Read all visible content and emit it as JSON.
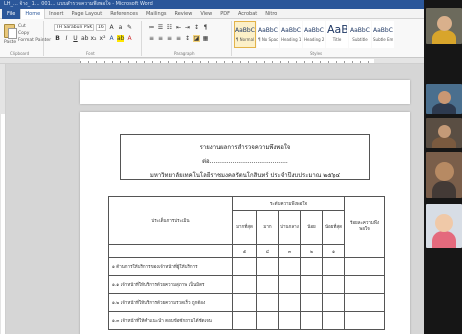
{
  "window": {
    "title_text": "LH_...  จ้าง_ 1... 001...  แบบสำรวจความพึงพอใจ - Microsoft Word"
  },
  "tabs": [
    "File",
    "Home",
    "Insert",
    "Page Layout",
    "References",
    "Mailings",
    "Review",
    "View",
    "PDF",
    "Acrobat",
    "Nitro"
  ],
  "active_tab": "Home",
  "ribbon": {
    "paste_label": "Paste",
    "cut_label": "Cut",
    "copy_label": "Copy",
    "format_painter_label": "Format Painter",
    "font_name": "TH Sarabun PSK",
    "font_size": "16",
    "styles": [
      {
        "sample": "AaBbCcDd",
        "name": "¶ Normal",
        "selected": true
      },
      {
        "sample": "AaBbCcDd",
        "name": "¶ No Spac...",
        "selected": false
      },
      {
        "sample": "AaBbC",
        "name": "Heading 1",
        "selected": false
      },
      {
        "sample": "AaBbCc",
        "name": "Heading 2",
        "selected": false
      },
      {
        "sample": "AaB",
        "name": "Title",
        "selected": false,
        "big": true
      },
      {
        "sample": "AaBbCcl",
        "name": "Subtitle",
        "selected": false
      },
      {
        "sample": "AaBbCcDd",
        "name": "Subtle Em...",
        "selected": false
      }
    ],
    "group_labels": [
      "Clipboard",
      "Font",
      "Paragraph",
      "Styles"
    ]
  },
  "document": {
    "heading_1": "รายงานผลการสำรวจความพึงพอใจ",
    "heading_2": "ต่อ.........................................",
    "heading_3": "มหาวิทยาลัยเทคโนโลยีราชมงคลรัตนโกสินทร์  ประจำปีงบประมาณ ๒๕๖๔",
    "table": {
      "item_header": "ประเด็นการประเมิน",
      "group_header": "ระดับความพึงพอใจ",
      "level_headers": [
        "มากที่สุด",
        "มาก",
        "ปานกลาง",
        "น้อย",
        "น้อยที่สุด"
      ],
      "extra_header": "ร้อยละความพึงพอใจ",
      "score_headers": [
        "๕",
        "๔",
        "๓",
        "๒",
        "๑"
      ],
      "rows": [
        "๑ ด้านการให้บริการของเจ้าหน้าที่ผู้ให้บริการ",
        "๑.๑ เจ้าหน้าที่ให้บริการด้วยความสุภาพ เป็นมิตร",
        "๑.๒ เจ้าหน้าที่ให้บริการด้วยความรวดเร็ว ถูกต้อง",
        "๑.๓ เจ้าหน้าที่ให้คำแนะนำ ตอบข้อซักถามได้ชัดเจน"
      ]
    }
  },
  "participants": [
    {
      "name": "participant-1",
      "bg": "#6c6a5c",
      "skin": "#d9b08c",
      "shirt": "#d8a52b"
    },
    {
      "name": "participant-2",
      "bg": "#4a6f8e",
      "skin": "#c99773",
      "shirt": "#2d3a4f"
    },
    {
      "name": "participant-3",
      "bg": "#5a4e43",
      "skin": "#c49a77",
      "shirt": "#7a5a3f"
    },
    {
      "name": "participant-4",
      "bg": "#7a5e4a",
      "skin": "#b78a63",
      "shirt": "#433a36"
    },
    {
      "name": "participant-5",
      "bg": "#d7dde5",
      "skin": "#f0c9a8",
      "shirt": "#e46a7d"
    }
  ]
}
